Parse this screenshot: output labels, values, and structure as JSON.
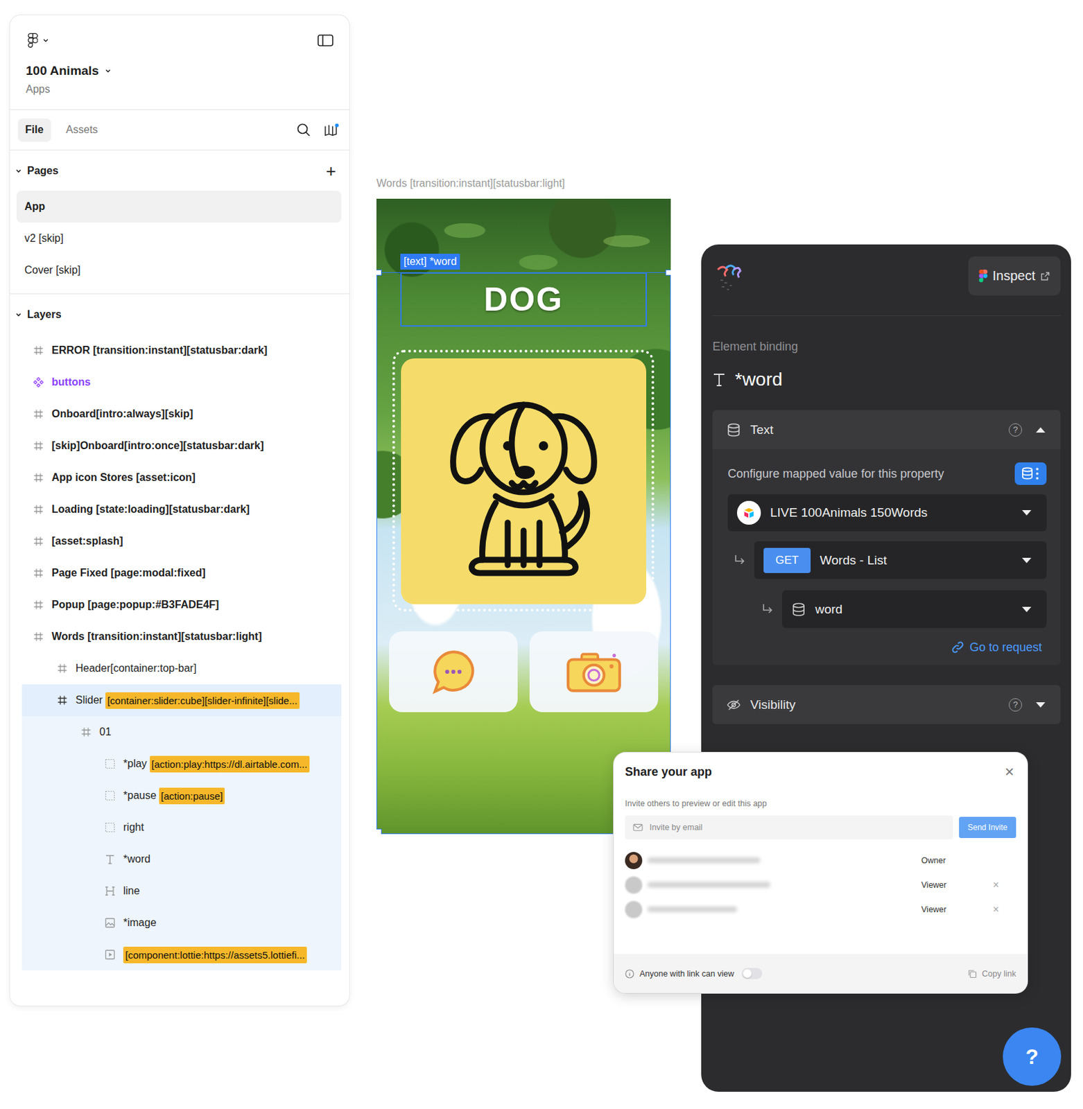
{
  "file_panel": {
    "project": "100 Animals",
    "team": "Apps",
    "tabs": [
      {
        "label": "File",
        "selected": true
      },
      {
        "label": "Assets",
        "selected": false
      }
    ],
    "pages": {
      "title": "Pages",
      "expanded": true,
      "add": "+",
      "items": [
        {
          "label": "App",
          "selected": true
        },
        {
          "label": "v2 [skip]",
          "selected": false
        },
        {
          "label": "Cover [skip]",
          "selected": false
        }
      ]
    },
    "layers": {
      "title": "Layers",
      "expanded": true,
      "items": [
        {
          "name": "ERROR [transition:instant][statusbar:dark]",
          "tag": "",
          "kind": "frame",
          "depth": 0,
          "selected": false,
          "highlighted": false
        },
        {
          "name": "buttons",
          "tag": "",
          "kind": "component",
          "depth": 0,
          "selected": false,
          "highlighted": false
        },
        {
          "name": "Onboard[intro:always][skip]",
          "tag": "",
          "kind": "frame",
          "depth": 0,
          "selected": false,
          "highlighted": false
        },
        {
          "name": "[skip]Onboard[intro:once][statusbar:dark]",
          "tag": "",
          "kind": "frame",
          "depth": 0,
          "selected": false,
          "highlighted": false
        },
        {
          "name": "App icon Stores [asset:icon]",
          "tag": "",
          "kind": "frame",
          "depth": 0,
          "selected": false,
          "highlighted": false
        },
        {
          "name": "Loading [state:loading][statusbar:dark]",
          "tag": "",
          "kind": "frame",
          "depth": 0,
          "selected": false,
          "highlighted": false
        },
        {
          "name": "[asset:splash]",
          "tag": "",
          "kind": "frame",
          "depth": 0,
          "selected": false,
          "highlighted": false
        },
        {
          "name": "Page Fixed [page:modal:fixed]",
          "tag": "",
          "kind": "frame",
          "depth": 0,
          "selected": false,
          "highlighted": false
        },
        {
          "name": "Popup [page:popup:#B3FADE4F]",
          "tag": "",
          "kind": "frame",
          "depth": 0,
          "selected": false,
          "highlighted": false
        },
        {
          "name": "Words [transition:instant][statusbar:light]",
          "tag": "",
          "kind": "frame",
          "depth": 0,
          "selected": false,
          "highlighted": false
        },
        {
          "name": "Header[container:top-bar]",
          "tag": "",
          "kind": "frame",
          "depth": 1,
          "selected": false,
          "highlighted": false
        },
        {
          "name": "Slider",
          "tag": "[container:slider:cube][slider-infinite][slide...",
          "kind": "frame",
          "depth": 1,
          "selected": true,
          "highlighted": true
        },
        {
          "name": "01",
          "tag": "",
          "kind": "frame",
          "depth": 2,
          "selected": false,
          "highlighted": true
        },
        {
          "name": "*play",
          "tag": "[action:play:https://dl.airtable.com...",
          "kind": "hotspot",
          "depth": 3,
          "selected": false,
          "highlighted": true
        },
        {
          "name": "*pause",
          "tag": "[action:pause]",
          "kind": "hotspot",
          "depth": 3,
          "selected": false,
          "highlighted": true
        },
        {
          "name": "right",
          "tag": "",
          "kind": "hotspot",
          "depth": 3,
          "selected": false,
          "highlighted": true
        },
        {
          "name": "*word",
          "tag": "",
          "kind": "text",
          "depth": 3,
          "selected": false,
          "highlighted": true
        },
        {
          "name": "line",
          "tag": "",
          "kind": "line",
          "depth": 3,
          "selected": false,
          "highlighted": true
        },
        {
          "name": "*image",
          "tag": "",
          "kind": "image",
          "depth": 3,
          "selected": false,
          "highlighted": true
        },
        {
          "name": "",
          "tag": "[component:lottie:https://assets5.lottiefi...",
          "kind": "lottie",
          "depth": 3,
          "selected": false,
          "highlighted": true
        }
      ]
    }
  },
  "canvas": {
    "frame_label": "Words [transition:instant][statusbar:light]",
    "selection_label": "[text] *word",
    "word": "DOG"
  },
  "binding_panel": {
    "inspect": "Inspect",
    "section_title": "Element binding",
    "element": "*word",
    "text_section": {
      "title": "Text",
      "help": "?",
      "expanded": true,
      "description": "Configure mapped value for this property",
      "source": "LIVE 100Animals 150Words",
      "method": "GET",
      "request": "Words - List",
      "field": "word",
      "link": "Go to request"
    },
    "visibility_section": {
      "title": "Visibility",
      "help": "?",
      "expanded": false
    }
  },
  "share_dialog": {
    "title": "Share your app",
    "close": "×",
    "subtitle": "Invite others to preview or edit this app",
    "email_placeholder": "Invite by email",
    "send": "Send Invite",
    "members": [
      {
        "role": "Owner",
        "removable": false
      },
      {
        "role": "Viewer",
        "removable": true
      },
      {
        "role": "Viewer",
        "removable": true
      }
    ],
    "remove": "×",
    "link_access": "Anyone with link can view",
    "link_access_on": false,
    "copy": "Copy link"
  },
  "help_button": "?"
}
